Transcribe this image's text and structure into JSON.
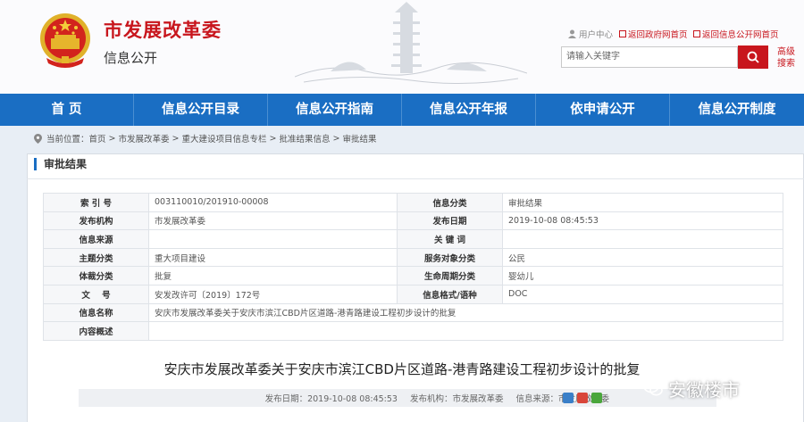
{
  "header": {
    "org_name": "市发展改革委",
    "org_sub": "信息公开",
    "links": {
      "user_center": "用户中心",
      "gov_home": "返回政府网首页",
      "info_home": "返回信息公开网首页"
    },
    "search": {
      "placeholder": "请输入关键字",
      "advanced": "高级搜索"
    }
  },
  "nav": [
    "首 页",
    "信息公开目录",
    "信息公开指南",
    "信息公开年报",
    "依申请公开",
    "信息公开制度"
  ],
  "breadcrumb": {
    "label": "当前位置：",
    "items": [
      "首页",
      "市发展改革委",
      "重大建设项目信息专栏",
      "批准结果信息",
      "审批结果"
    ]
  },
  "panel": {
    "title": "审批结果",
    "rows": [
      {
        "k1": "索 引 号",
        "v1": "003110010/201910-00008",
        "k2": "信息分类",
        "v2": "审批结果"
      },
      {
        "k1": "发布机构",
        "v1": "市发展改革委",
        "k2": "发布日期",
        "v2": "2019-10-08 08:45:53"
      },
      {
        "k1": "信息来源",
        "v1": "",
        "k2": "关 键 词",
        "v2": ""
      },
      {
        "k1": "主题分类",
        "v1": "重大项目建设",
        "k2": "服务对象分类",
        "v2": "公民"
      },
      {
        "k1": "体裁分类",
        "v1": "批复",
        "k2": "生命周期分类",
        "v2": "婴幼儿"
      },
      {
        "k1": "文    号",
        "v1": "安发改许可〔2019〕172号",
        "k2": "信息格式/语种",
        "v2": "DOC"
      }
    ],
    "name_label": "信息名称",
    "name_value": "安庆市发展改革委关于安庆市滨江CBD片区道路-港青路建设工程初步设计的批复",
    "summary_label": "内容概述",
    "summary_value": ""
  },
  "article": {
    "title": "安庆市发展改革委关于安庆市滨江CBD片区道路-港青路建设工程初步设计的批复",
    "publish_time": "发布日期：2019-10-08 08:45:53",
    "publisher": "发布机构：市发展改革委",
    "source": "信息来源：市发展改革委"
  },
  "watermark": "安徽楼市",
  "colors": {
    "brand_red": "#c8161d",
    "nav_blue": "#1a6ec3"
  }
}
